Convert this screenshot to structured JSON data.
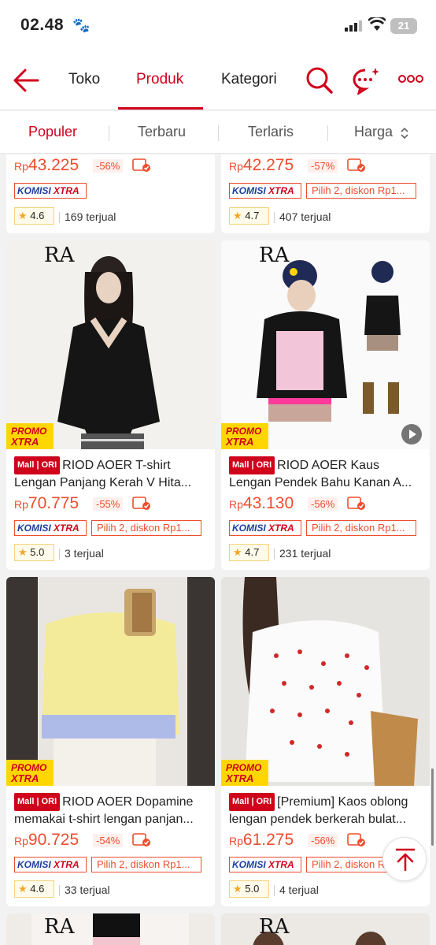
{
  "status_bar": {
    "time": "02.48",
    "battery": "21"
  },
  "nav": {
    "tabs": [
      "Toko",
      "Produk",
      "Kategori"
    ],
    "active_tab": "Produk"
  },
  "sort": {
    "options": [
      "Populer",
      "Terbaru",
      "Terlaris",
      "Harga"
    ],
    "active": "Populer"
  },
  "labels": {
    "promo_line1": "PROMO",
    "promo_line2": "XTRA",
    "komisi_a": "KOMISI",
    "komisi_b": "XTRA",
    "mall": "Mall | ORI",
    "currency": "Rp"
  },
  "colors": {
    "brand": "#d0011b",
    "price": "#ee4d2d",
    "promo_bg": "#ffd600",
    "star": "#f5a623"
  },
  "products": [
    {
      "price": "43.225",
      "discount": "-56%",
      "pilih": "",
      "rating": "4.6",
      "sold": "169 terjual"
    },
    {
      "price": "42.275",
      "discount": "-57%",
      "pilih": "Pilih 2, diskon Rp1...",
      "rating": "4.7",
      "sold": "407 terjual"
    },
    {
      "title": "RIOD AOER T-shirt Lengan Panjang Kerah V Hita...",
      "price": "70.775",
      "discount": "-55%",
      "pilih": "Pilih 2, diskon Rp1...",
      "rating": "5.0",
      "sold": "3 terjual",
      "brand_logo": "RA"
    },
    {
      "title": "RIOD AOER Kaus Lengan Pendek Bahu Kanan A...",
      "price": "43.130",
      "discount": "-56%",
      "pilih": "Pilih 2, diskon Rp1...",
      "rating": "4.7",
      "sold": "231 terjual",
      "brand_logo": "RA"
    },
    {
      "title": "RIOD AOER Dopamine memakai t-shirt lengan panjan...",
      "price": "90.725",
      "discount": "-54%",
      "pilih": "Pilih 2, diskon Rp1...",
      "rating": "4.6",
      "sold": "33 terjual"
    },
    {
      "title": "[Premium] Kaos oblong lengan pendek berkerah bulat...",
      "price": "61.275",
      "discount": "-56%",
      "pilih": "Pilih 2, diskon Rp1...",
      "rating": "5.0",
      "sold": "4 terjual"
    },
    {
      "brand_logo": "RA"
    },
    {
      "brand_logo": "RA"
    }
  ]
}
